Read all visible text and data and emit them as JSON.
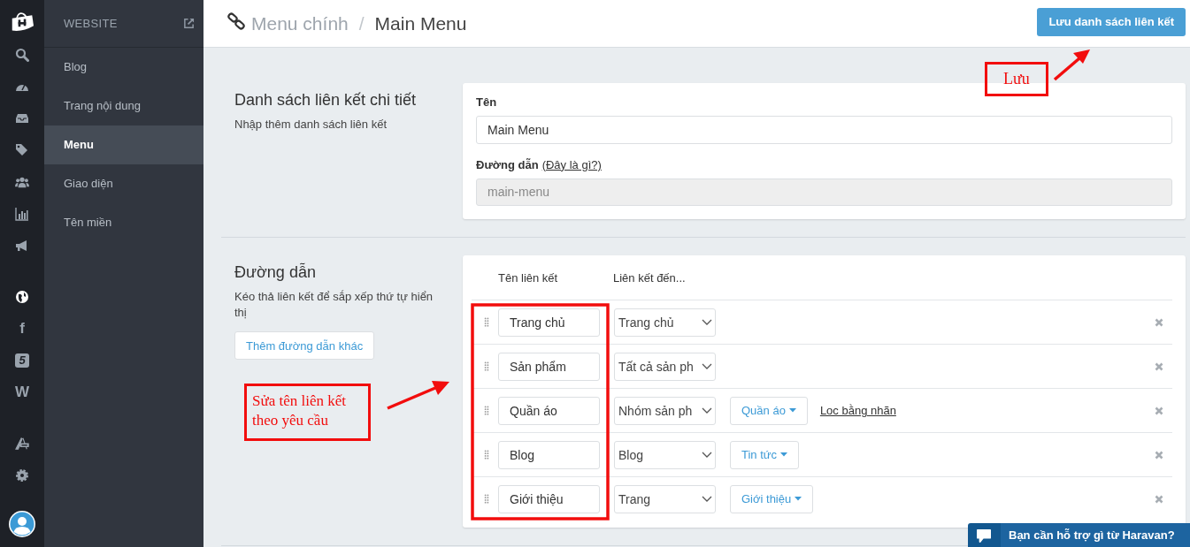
{
  "rail": {
    "items": [
      {
        "kind": "logo"
      },
      {
        "kind": "search"
      },
      {
        "kind": "gauge"
      },
      {
        "kind": "tray"
      },
      {
        "kind": "tag"
      },
      {
        "kind": "users"
      },
      {
        "kind": "chart"
      },
      {
        "kind": "megaphone"
      },
      {
        "kind": "gap"
      },
      {
        "kind": "globe"
      },
      {
        "kind": "letter",
        "text": "f"
      },
      {
        "kind": "badge",
        "text": "5"
      },
      {
        "kind": "letter",
        "text": "W"
      },
      {
        "kind": "gap"
      },
      {
        "kind": "tool"
      },
      {
        "kind": "gear"
      },
      {
        "kind": "avatar"
      }
    ]
  },
  "sidebar": {
    "title": "WEBSITE",
    "items": [
      {
        "label": "Blog",
        "selected": false
      },
      {
        "label": "Trang nội dung",
        "selected": false
      },
      {
        "label": "Menu",
        "selected": true
      },
      {
        "label": "Giao diện",
        "selected": false
      },
      {
        "label": "Tên miền",
        "selected": false
      }
    ]
  },
  "header": {
    "breadcrumb": "Menu chính",
    "separator": "/",
    "title": "Main Menu",
    "save_button": "Lưu danh sách liên kết"
  },
  "details": {
    "title": "Danh sách liên kết chi tiết",
    "description": "Nhập thêm danh sách liên kết",
    "name_label": "Tên",
    "name_value": "Main Menu",
    "handle_label": "Đường dẫn",
    "handle_help": "(Đây là gì?)",
    "handle_value": "main-menu",
    "handle_disabled": true
  },
  "links": {
    "title": "Đường dẫn",
    "description": "Kéo thả liên kết để sắp xếp thứ tự hiển thị",
    "add_button": "Thêm đường dẫn khác",
    "columns": [
      "Tên liên kết",
      "Liên kết đến..."
    ],
    "rows": [
      {
        "name": "Trang chủ",
        "target": "Trang chủ"
      },
      {
        "name": "Sản phẩm",
        "target": "Tất cả sản ph"
      },
      {
        "name": "Quần áo",
        "target": "Nhóm sản ph",
        "item": "Quần áo",
        "filter_link": "Loc bằng nhãn"
      },
      {
        "name": "Blog",
        "target": "Blog",
        "item": "Tin tức"
      },
      {
        "name": "Giới thiệu",
        "target": "Trang",
        "item": "Giới thiệu"
      }
    ]
  },
  "annotations": [
    {
      "text": "Lưu"
    },
    {
      "text": "Sửa tên liên kết theo yêu cầu"
    }
  ],
  "chat": {
    "text": "Bạn cần hỗ trợ gì từ Haravan?"
  }
}
